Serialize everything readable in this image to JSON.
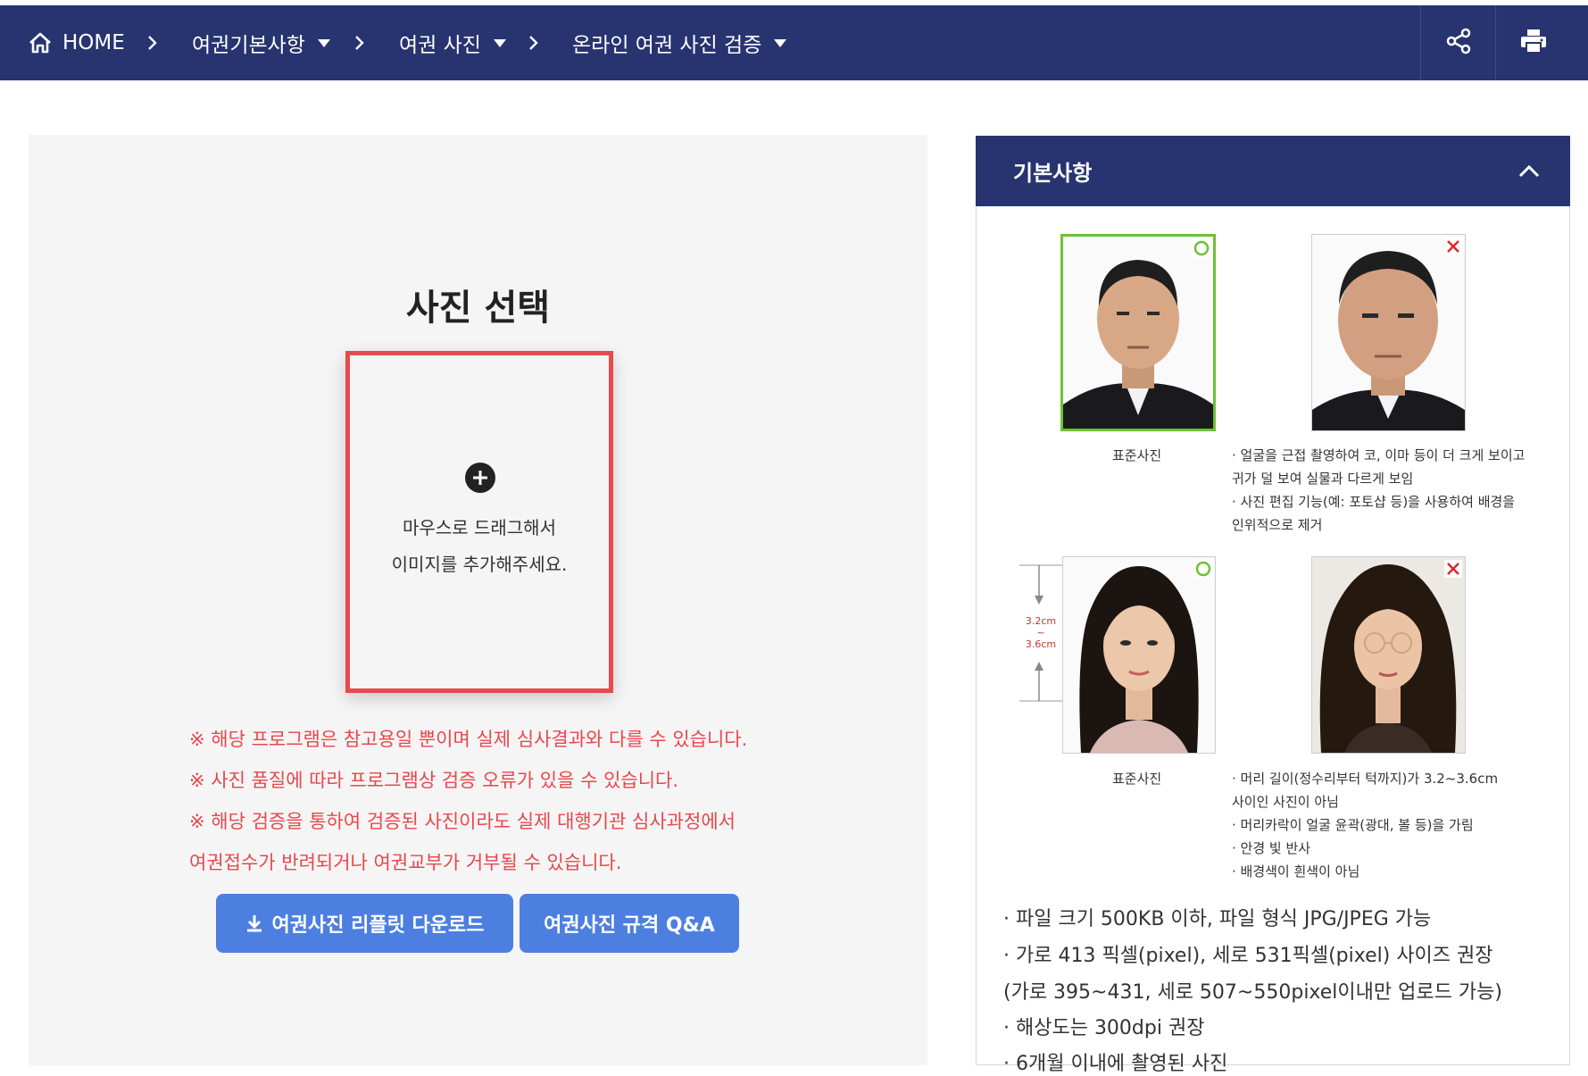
{
  "nav": {
    "home_label": "HOME",
    "crumbs": [
      {
        "label": "여권기본사항"
      },
      {
        "label": "여권 사진"
      },
      {
        "label": "온라인 여권 사진 검증"
      }
    ],
    "share_icon": "share-icon",
    "print_icon": "print-icon",
    "bg_color": "#283470"
  },
  "upload": {
    "title": "사진 선택",
    "drop_line1": "마우스로 드래그해서",
    "drop_line2": "이미지를 추가해주세요.",
    "border_color": "#e84a4f"
  },
  "notices": [
    "※ 해당 프로그램은 참고용일 뿐이며 실제 심사결과와 다를 수 있습니다.",
    "※ 사진 품질에 따라 프로그램상 검증 오류가 있을 수 있습니다.",
    "※ 해당 검증을 통하여 검증된 사진이라도 실제 대행기관 심사과정에서",
    "여권접수가 반려되거나 여권교부가 거부될 수 있습니다."
  ],
  "buttons": {
    "download_label": "여권사진 리플릿 다운로드",
    "qa_label": "여권사진 규격 Q&A",
    "color": "#4d7fe0"
  },
  "right_panel": {
    "title": "기본사항",
    "example1": {
      "caption": "표준사진",
      "bad_notes": [
        "· 얼굴을 근접 촬영하여 코, 이마 등이 더 크게 보이고",
        "  귀가 덜 보여 실물과 다르게 보임",
        "· 사진 편집 기능(예: 포토샵 등)을 사용하여 배경을",
        "  인위적으로 제거"
      ]
    },
    "example2": {
      "caption": "표준사진",
      "measure_top": "3.2cm",
      "measure_mid": "~",
      "measure_bottom": "3.6cm",
      "bad_notes": [
        "· 머리 길이(정수리부터 턱까지)가 3.2~3.6cm",
        "  사이인 사진이 아님",
        "· 머리카락이 얼굴 윤곽(광대, 볼 등)을 가림",
        "· 안경 빛 반사",
        "· 배경색이 흰색이 아님"
      ]
    },
    "info": [
      "·  파일 크기 500KB 이하, 파일 형식 JPG/JPEG 가능",
      "·  가로 413 픽셀(pixel), 세로 531픽셀(pixel) 사이즈 권장",
      "   (가로 395~431, 세로 507~550pixel이내만 업로드 가능)",
      "·  해상도는 300dpi 권장",
      "·  6개월 이내에 촬영된 사진"
    ],
    "good_mark_color": "#6cc233",
    "bad_mark_color": "#e0252b"
  }
}
